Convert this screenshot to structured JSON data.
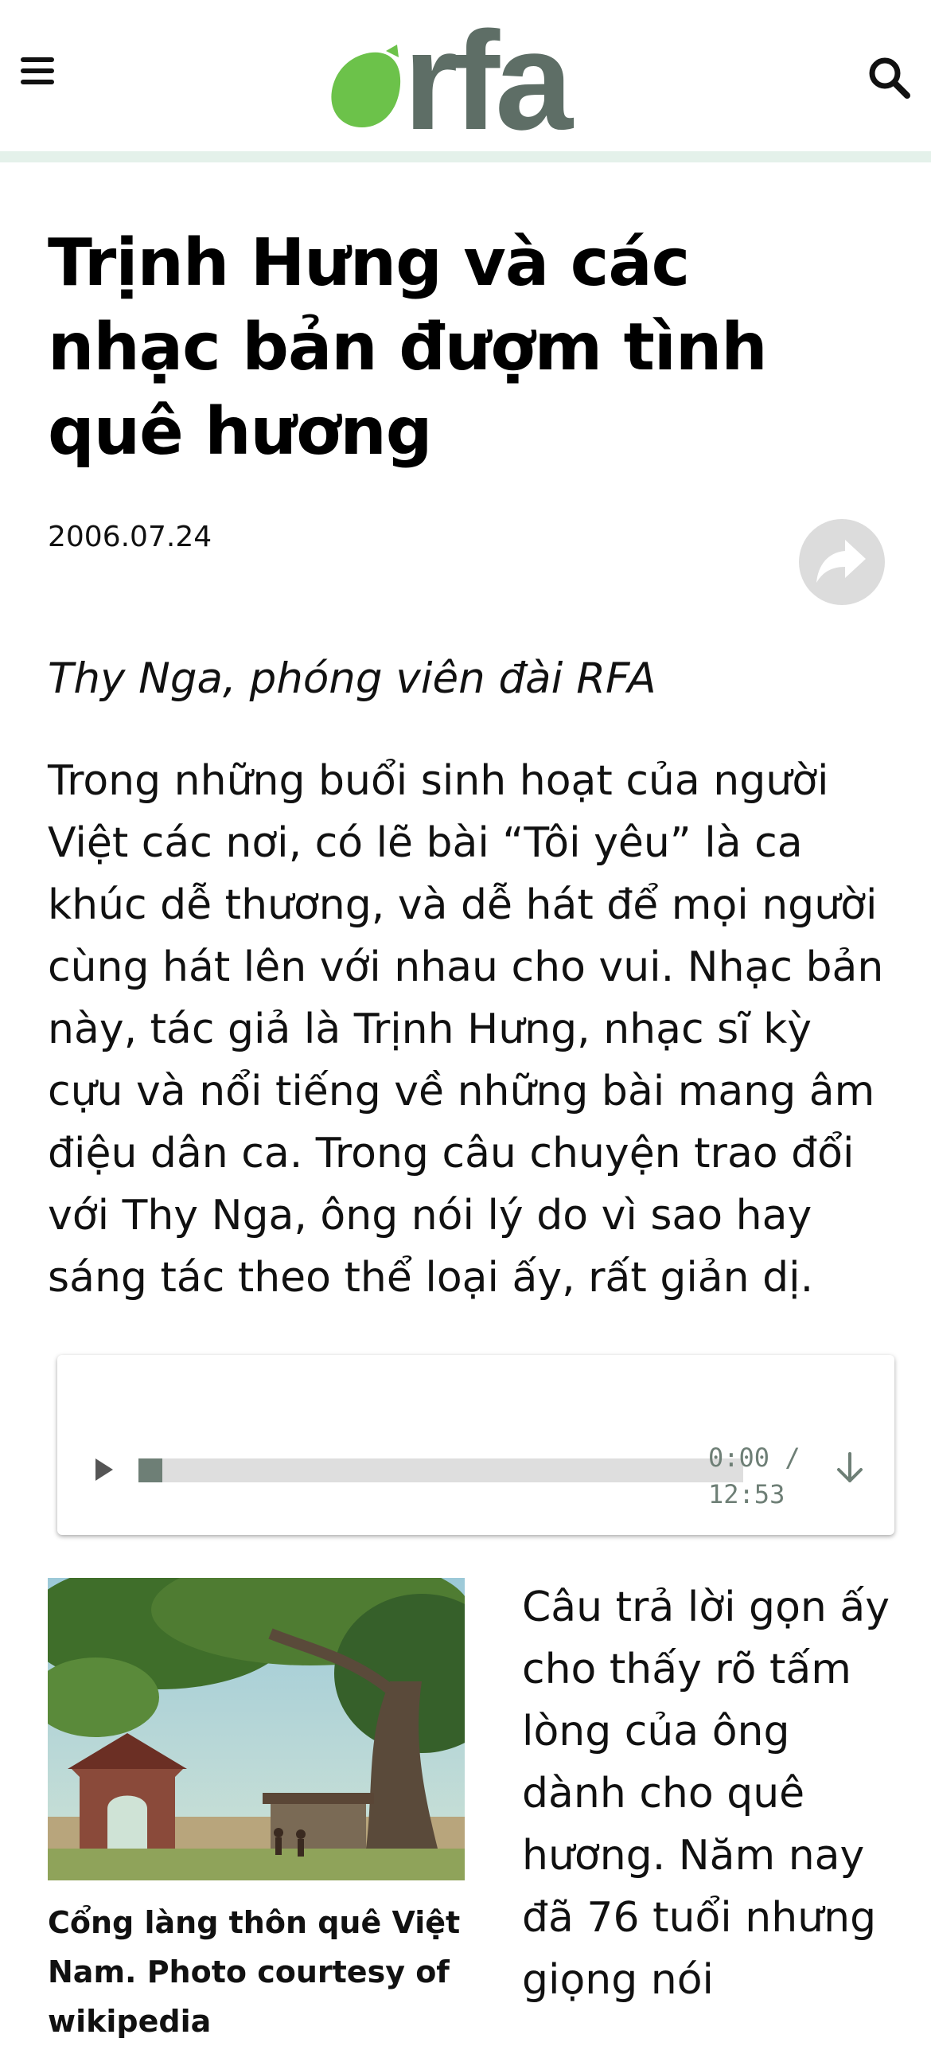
{
  "header": {
    "logo_text": "rfa",
    "menu_icon": "hamburger-menu-icon",
    "search_icon": "search-icon",
    "brand_green": "#6cc24a",
    "brand_gray": "#5e6e66",
    "rule_color": "#e4f1ea"
  },
  "article": {
    "title": "Trịnh Hưng và các nhạc bản đượm tình quê hương",
    "date": "2006.07.24",
    "share_icon": "share-arrow-icon",
    "byline": "Thy Nga, phóng viên đài RFA",
    "lead": "Trong những buổi sinh hoạt của người Việt các nơi, có lẽ bài “Tôi yêu” là ca khúc dễ thương, và dễ hát để mọi người cùng hát lên với nhau cho vui. Nhạc bản này, tác giả là Trịnh Hưng, nhạc sĩ kỳ cựu và nổi tiếng về những bài mang âm điệu dân ca. Trong câu chuyện trao đổi với Thy Nga, ông nói lý do vì sao hay sáng tác theo thể loại ấy, rất giản dị.",
    "caption": "Cổng làng thôn quê Việt Nam. Photo courtesy of wikipedia",
    "body": "Câu trả lời gọn ấy cho thấy rõ tấm lòng của ông dành cho quê hương. Năm nay đã 76 tuổi nhưng giọng nói"
  },
  "audio": {
    "current_time": "0:00",
    "separator": "/",
    "duration": "12:53",
    "progress": 0.0,
    "play_icon": "play-icon",
    "download_icon": "download-arrow-icon"
  }
}
